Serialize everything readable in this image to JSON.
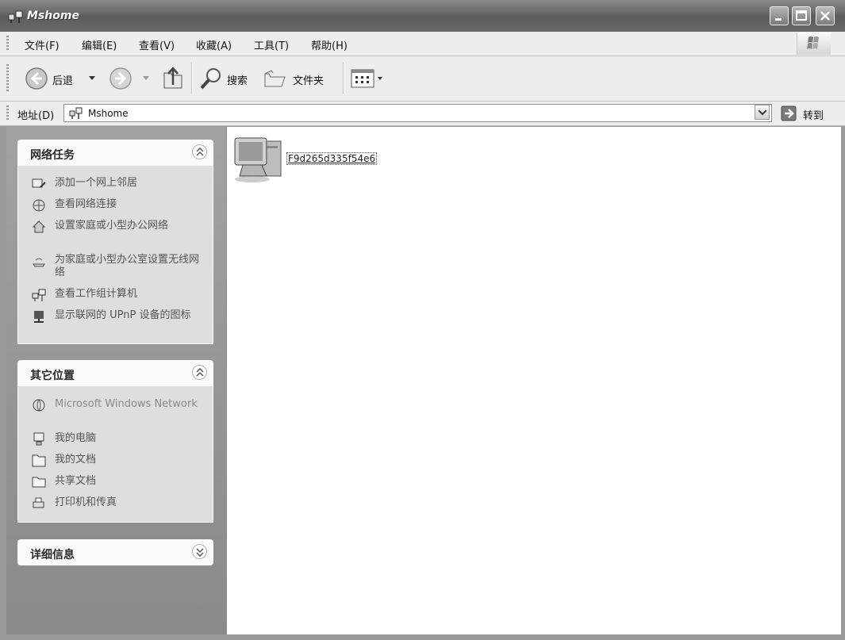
{
  "window": {
    "title": "Mshome"
  },
  "menubar": {
    "items": [
      "文件(F)",
      "编辑(E)",
      "查看(V)",
      "收藏(A)",
      "工具(T)",
      "帮助(H)"
    ]
  },
  "toolbar": {
    "back_label": "后退",
    "search_label": "搜索",
    "folders_label": "文件夹"
  },
  "address": {
    "label": "地址(D)",
    "value": "Mshome",
    "go_label": "转到"
  },
  "network_tasks": {
    "title": "网络任务",
    "items": [
      {
        "label": "添加一个网上邻居",
        "icon": "add-network-place-icon"
      },
      {
        "label": "查看网络连接",
        "icon": "network-connections-icon"
      },
      {
        "label": "设置家庭或小型办公网络",
        "icon": "home-network-setup-icon"
      },
      {
        "label": "为家庭或小型办公室设置无线网络",
        "icon": "wireless-setup-icon"
      },
      {
        "label": "查看工作组计算机",
        "icon": "workgroup-computers-icon"
      },
      {
        "label": "显示联网的 UPnP 设备的图标",
        "icon": "upnp-device-icon"
      }
    ]
  },
  "other_places": {
    "title": "其它位置",
    "items": [
      {
        "label": "Microsoft Windows Network",
        "icon": "windows-network-icon"
      },
      {
        "label": "我的电脑",
        "icon": "my-computer-icon"
      },
      {
        "label": "我的文档",
        "icon": "my-documents-icon"
      },
      {
        "label": "共享文档",
        "icon": "shared-documents-icon"
      },
      {
        "label": "打印机和传真",
        "icon": "printers-faxes-icon"
      }
    ]
  },
  "details": {
    "title": "详细信息"
  },
  "content": {
    "items": [
      {
        "label": "F9d265d335f54e6",
        "icon": "computer-icon"
      }
    ]
  }
}
